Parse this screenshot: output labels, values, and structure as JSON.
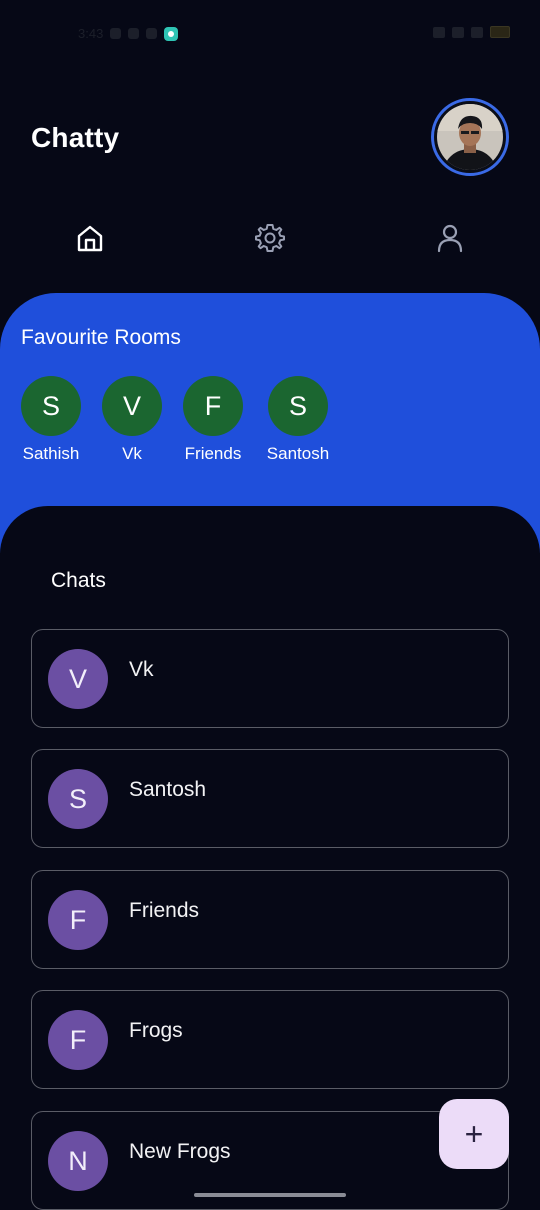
{
  "status_bar": {
    "time": "3:43"
  },
  "app": {
    "title": "Chatty"
  },
  "tabs": [
    {
      "name": "home",
      "icon": "home-icon",
      "active": true
    },
    {
      "name": "settings",
      "icon": "gear-icon",
      "active": false
    },
    {
      "name": "profile",
      "icon": "user-icon",
      "active": false
    }
  ],
  "favourites": {
    "title": "Favourite Rooms",
    "items": [
      {
        "initial": "S",
        "label": "Sathish"
      },
      {
        "initial": "V",
        "label": "Vk"
      },
      {
        "initial": "F",
        "label": "Friends"
      },
      {
        "initial": "S",
        "label": "Santosh"
      }
    ]
  },
  "chats": {
    "title": "Chats",
    "items": [
      {
        "initial": "V",
        "name": "Vk"
      },
      {
        "initial": "S",
        "name": "Santosh"
      },
      {
        "initial": "F",
        "name": "Friends"
      },
      {
        "initial": "F",
        "name": "Frogs"
      },
      {
        "initial": "N",
        "name": "New Frogs"
      }
    ]
  },
  "fab": {
    "label": "+"
  },
  "colors": {
    "background": "#060816",
    "favourites_panel": "#1f4fdb",
    "favourite_avatar": "#1b6630",
    "chat_avatar": "#6b4fa3",
    "fab": "#ecdcf8",
    "avatar_ring": "#3a6ae6"
  }
}
